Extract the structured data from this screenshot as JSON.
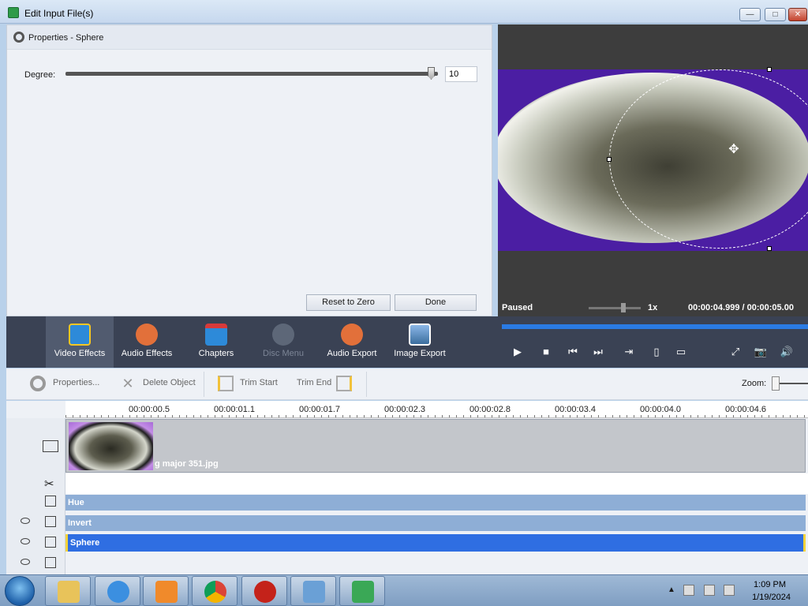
{
  "window": {
    "title": "Edit Input File(s)",
    "minimize": "—",
    "maximize": "□",
    "close": "✕"
  },
  "properties": {
    "header": "Properties - Sphere",
    "degree_label": "Degree:",
    "degree_value": "10",
    "reset_label": "Reset to Zero",
    "done_label": "Done"
  },
  "preview": {
    "status": "Paused",
    "speed": "1x",
    "time": "00:00:04.999  /  00:00:05.00",
    "move_glyph": "✥"
  },
  "toolbar": {
    "items": [
      {
        "label": "Video Effects"
      },
      {
        "label": "Audio Effects"
      },
      {
        "label": "Chapters"
      },
      {
        "label": "Disc Menu"
      },
      {
        "label": "Audio Export"
      },
      {
        "label": "Image Export"
      }
    ],
    "controls": {
      "play": "▶",
      "stop": "■",
      "prev": "⏮",
      "next": "⏭",
      "split": "⇥",
      "f1": "▯",
      "f2": "▭",
      "fullscreen": "⤢",
      "snapshot": "📷",
      "volume": "🔊"
    }
  },
  "object_bar": {
    "properties": "Properties...",
    "delete": "Delete Object",
    "trim_start": "Trim Start",
    "trim_end": "Trim End",
    "zoom": "Zoom:"
  },
  "timeline": {
    "ticks": [
      "00:00:00.5",
      "00:00:01.1",
      "00:00:01.7",
      "00:00:02.3",
      "00:00:02.8",
      "00:00:03.4",
      "00:00:04.0",
      "00:00:04.6"
    ],
    "clip_name": "g major 351.jpg",
    "effects": [
      {
        "name": "Hue"
      },
      {
        "name": "Invert"
      },
      {
        "name": "Sphere",
        "selected": true
      }
    ]
  },
  "taskbar": {
    "time": "1:09 PM",
    "date": "1/19/2024"
  },
  "colors": {
    "accent": "#2f6ee2",
    "progress": "#2a7be4",
    "effect_track": "#8eaed6",
    "toolbar_bg": "#3a4254"
  }
}
